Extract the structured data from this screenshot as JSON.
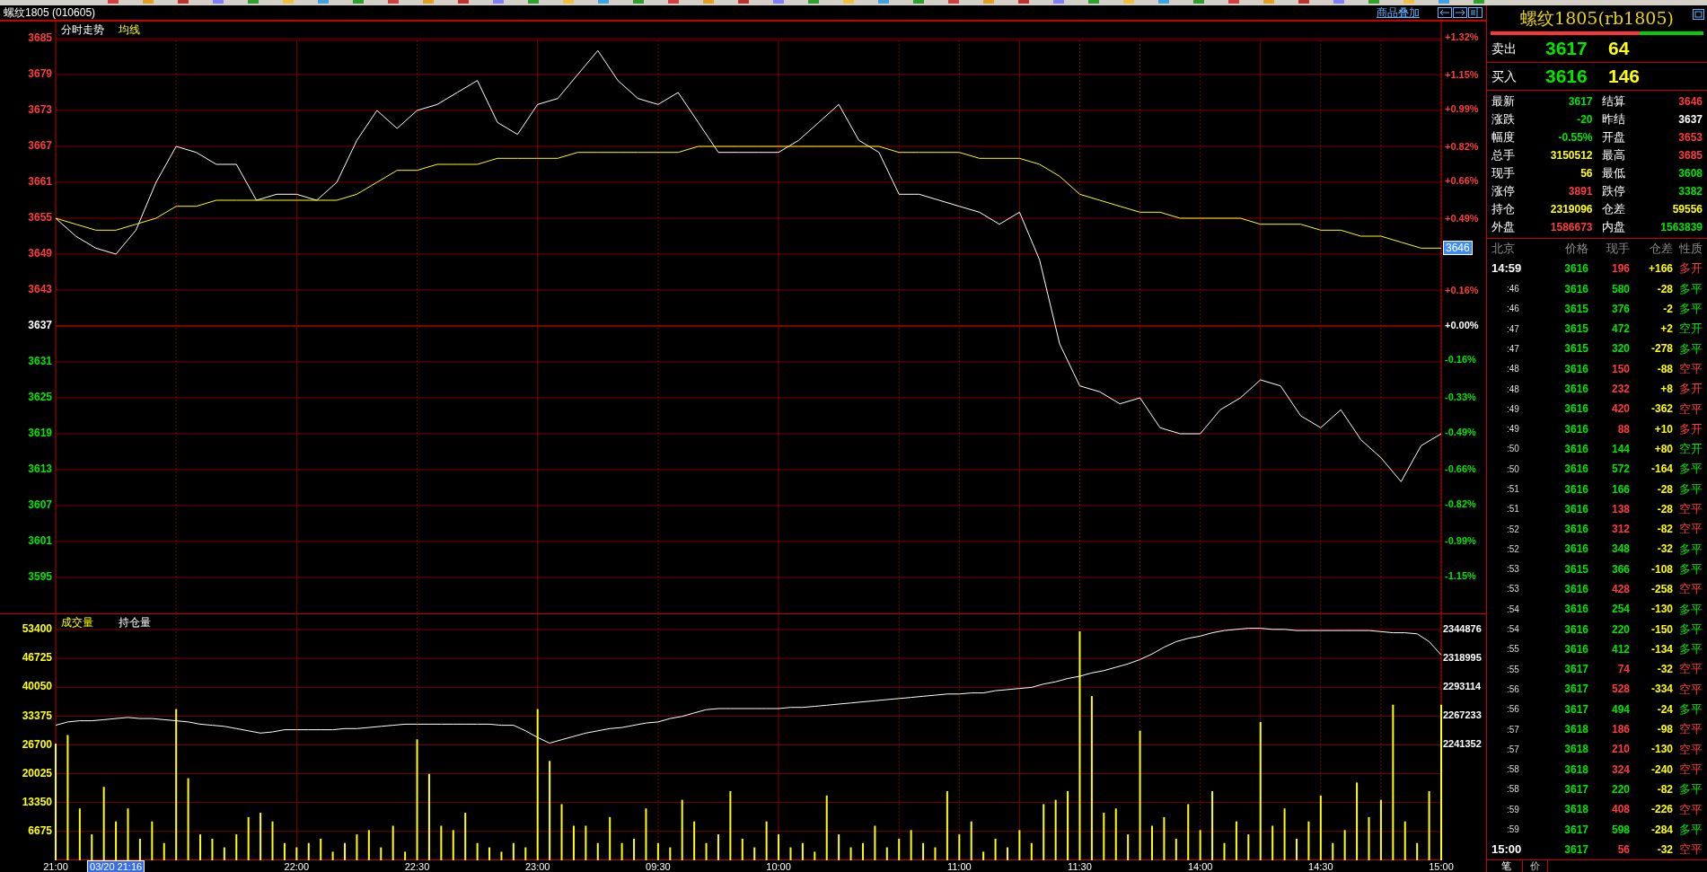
{
  "title_bar": {
    "title": "螺纹1805 (010605)",
    "link": "商品叠加"
  },
  "price_chart": {
    "price_marker": "3646",
    "chart_data": {
      "type": "line",
      "grid": true,
      "categories": [
        null,
        null,
        null,
        null,
        null,
        null,
        null,
        null,
        null,
        null,
        null,
        null,
        null,
        null,
        null,
        null,
        null,
        null,
        null,
        null,
        null,
        null,
        null,
        null,
        null,
        null,
        null,
        null,
        null,
        null,
        null,
        null,
        null,
        null,
        null,
        null,
        null,
        null,
        null,
        null,
        null,
        null,
        null,
        null,
        null,
        null,
        null,
        null,
        null,
        null,
        null,
        null,
        null,
        null,
        null,
        null,
        null,
        null,
        null,
        null,
        null,
        null,
        null,
        null,
        null,
        null,
        null,
        null,
        null,
        null
      ],
      "ylim": [
        3589,
        3688
      ],
      "y2lim": [
        -1.32,
        1.4
      ],
      "ref_lines": [
        {
          "axis": "y",
          "value": 3637
        }
      ],
      "yticks": [
        3685,
        3679,
        3673,
        3667,
        3661,
        3655,
        3649,
        3643,
        3637,
        3631,
        3625,
        3619,
        3613,
        3607,
        3601,
        3595
      ],
      "y2ticks": [
        {
          "value": 1.32,
          "label": "+1.32%"
        },
        {
          "value": 1.15,
          "label": "+1.15%"
        },
        {
          "value": 0.99,
          "label": "+0.99%"
        },
        {
          "value": 0.82,
          "label": "+0.82%"
        },
        {
          "value": 0.66,
          "label": "+0.66%"
        },
        {
          "value": 0.49,
          "label": "+0.49%"
        },
        {
          "value": 0.16,
          "label": "+0.16%"
        },
        {
          "value": 0,
          "label": "+0.00%"
        },
        {
          "value": -0.16,
          "label": "-0.16%"
        },
        {
          "value": -0.33,
          "label": "-0.33%"
        },
        {
          "value": -0.49,
          "label": "-0.49%"
        },
        {
          "value": -0.66,
          "label": "-0.66%"
        },
        {
          "value": -0.82,
          "label": "-0.82%"
        },
        {
          "value": -0.99,
          "label": "-0.99%"
        },
        {
          "value": -1.15,
          "label": "-1.15%"
        }
      ],
      "series": [
        {
          "name": "分时走势",
          "color": "#ffffff",
          "values": [
            3655,
            3652,
            3650,
            3649,
            3653,
            3661,
            3667,
            3666,
            3664,
            3664,
            3658,
            3659,
            3659,
            3658,
            3661,
            3668,
            3673,
            3670,
            3673,
            3674,
            3676,
            3678,
            3671,
            3669,
            3674,
            3675,
            3679,
            3683,
            3678,
            3675,
            3674,
            3676,
            3671,
            3666,
            3666,
            3666,
            3666,
            3668,
            3671,
            3674,
            3668,
            3666,
            3659,
            3659,
            3658,
            3657,
            3656,
            3654,
            3656,
            3648,
            3634,
            3627,
            3626,
            3624,
            3625,
            3620,
            3619,
            3619,
            3623,
            3625,
            3628,
            3627,
            3622,
            3620,
            3623,
            3618,
            3615,
            3611,
            3617,
            3619
          ]
        },
        {
          "name": "均线",
          "color": "#ffff00",
          "values": [
            3655,
            3654,
            3653,
            3653,
            3654,
            3655,
            3657,
            3657,
            3658,
            3658,
            3658,
            3658,
            3658,
            3658,
            3658,
            3659,
            3661,
            3663,
            3663,
            3664,
            3664,
            3664,
            3665,
            3665,
            3665,
            3665,
            3666,
            3666,
            3666,
            3666,
            3666,
            3666,
            3667,
            3667,
            3667,
            3667,
            3667,
            3667,
            3667,
            3667,
            3667,
            3667,
            3666,
            3666,
            3666,
            3666,
            3665,
            3665,
            3665,
            3664,
            3662,
            3659,
            3658,
            3657,
            3656,
            3656,
            3655,
            3655,
            3655,
            3655,
            3654,
            3654,
            3654,
            3653,
            3653,
            3652,
            3652,
            3651,
            3650,
            3650
          ]
        }
      ]
    }
  },
  "volume_chart": {
    "cursor_label": "03/20 21:16",
    "chart_data": {
      "type": "bar",
      "grid": true,
      "ylim": [
        0,
        57140
      ],
      "y2lim": [
        2137828,
        2359377
      ],
      "categories": [
        "21:00",
        null,
        null,
        null,
        null,
        null,
        null,
        null,
        null,
        null,
        null,
        null,
        null,
        null,
        null,
        null,
        null,
        null,
        null,
        null,
        "22:00",
        null,
        null,
        null,
        null,
        null,
        null,
        null,
        null,
        null,
        "22:30",
        null,
        null,
        null,
        null,
        null,
        null,
        null,
        null,
        null,
        "23:00",
        null,
        null,
        null,
        null,
        null,
        null,
        null,
        null,
        null,
        "09:30",
        null,
        null,
        null,
        null,
        null,
        null,
        null,
        null,
        null,
        "10:00",
        null,
        null,
        null,
        null,
        null,
        null,
        null,
        null,
        null,
        null,
        null,
        null,
        null,
        null,
        "11:00",
        null,
        null,
        null,
        null,
        null,
        null,
        null,
        null,
        null,
        "11:30",
        null,
        null,
        null,
        null,
        null,
        null,
        null,
        null,
        null,
        "14:00",
        null,
        null,
        null,
        null,
        null,
        null,
        null,
        null,
        null,
        "14:30",
        null,
        null,
        null,
        null,
        null,
        null,
        null,
        null,
        null,
        "15:00"
      ],
      "yticks": [
        53400,
        46725,
        40050,
        33375,
        26700,
        20025,
        13350,
        6675
      ],
      "y2ticks": [
        2344876,
        2318995,
        2293114,
        2267233,
        2241352
      ],
      "series": [
        {
          "name": "成交量",
          "color": "#ffff00",
          "values": [
            27000,
            29000,
            12000,
            6000,
            17000,
            9000,
            12000,
            5000,
            9000,
            4000,
            35000,
            19000,
            6000,
            5000,
            3000,
            6000,
            10000,
            11000,
            9000,
            4000,
            3000,
            4000,
            5000,
            2000,
            4000,
            6000,
            7000,
            3000,
            8000,
            2000,
            28000,
            20000,
            8000,
            7000,
            11000,
            4000,
            3000,
            2000,
            4000,
            3000,
            35000,
            23000,
            13000,
            8000,
            8000,
            4000,
            10000,
            4000,
            5000,
            12000,
            4000,
            3000,
            14000,
            9000,
            4000,
            6000,
            16000,
            5000,
            3000,
            9000,
            6000,
            3000,
            4000,
            2000,
            15000,
            6000,
            3000,
            4000,
            8000,
            3000,
            5000,
            7000,
            4000,
            3000,
            16000,
            6000,
            9000,
            2000,
            5000,
            3000,
            7000,
            4000,
            13000,
            14000,
            16000,
            53000,
            38000,
            11000,
            12000,
            6000,
            30000,
            8000,
            10000,
            5000,
            13000,
            7000,
            16000,
            4000,
            9000,
            6000,
            32000,
            8000,
            12000,
            5000,
            9000,
            15000,
            4000,
            7000,
            18000,
            10000,
            14000,
            36000,
            9000,
            4000,
            16000,
            36000
          ]
        },
        {
          "name": "持仓量",
          "color": "#ffffff",
          "type": "line",
          "axis": "y2",
          "values": [
            2259000,
            2262000,
            2263000,
            2263000,
            2264000,
            2265000,
            2266000,
            2265000,
            2265000,
            2264000,
            2263000,
            2262000,
            2260000,
            2259000,
            2258000,
            2256000,
            2254000,
            2252000,
            2253000,
            2255000,
            2255000,
            2255000,
            2255000,
            2255000,
            2256000,
            2256000,
            2257000,
            2258000,
            2259000,
            2260000,
            2260000,
            2260000,
            2260000,
            2260000,
            2260000,
            2260000,
            2260000,
            2259000,
            2259000,
            2254000,
            2248000,
            2243000,
            2246000,
            2249000,
            2252000,
            2254000,
            2256000,
            2257000,
            2259000,
            2261000,
            2262000,
            2265000,
            2267000,
            2270000,
            2273000,
            2274000,
            2274000,
            2274000,
            2274000,
            2274000,
            2274000,
            2275000,
            2275000,
            2276000,
            2277000,
            2278000,
            2279000,
            2280000,
            2281000,
            2282000,
            2283000,
            2284000,
            2285000,
            2286000,
            2287000,
            2287000,
            2288000,
            2288000,
            2290000,
            2291000,
            2292000,
            2293000,
            2296000,
            2298000,
            2301000,
            2303000,
            2306000,
            2308000,
            2311000,
            2314000,
            2318000,
            2323000,
            2329000,
            2334000,
            2337000,
            2339000,
            2342000,
            2344000,
            2345000,
            2346000,
            2346000,
            2345000,
            2345000,
            2344000,
            2344000,
            2344000,
            2344000,
            2344000,
            2344000,
            2344000,
            2343000,
            2342000,
            2342000,
            2341000,
            2334000,
            2322000
          ]
        }
      ]
    }
  },
  "quote": {
    "title": "螺纹1805(rb1805)",
    "balance": {
      "level": 0.7
    },
    "book": [
      {
        "label": "卖出",
        "price": "3617",
        "volume": "64"
      },
      {
        "label": "买入",
        "price": "3616",
        "volume": "146"
      }
    ],
    "stats": [
      {
        "label": "最新",
        "value": "3617",
        "color": "#00e600"
      },
      {
        "label": "结算",
        "value": "3646",
        "color": "#ff3c3c"
      },
      {
        "label": "涨跌",
        "value": "-20",
        "color": "#00e600"
      },
      {
        "label": "昨结",
        "value": "3637",
        "color": "#ffffff"
      },
      {
        "label": "幅度",
        "value": "-0.55%",
        "color": "#00e600"
      },
      {
        "label": "开盘",
        "value": "3653",
        "color": "#ff3c3c"
      },
      {
        "label": "总手",
        "value": "3150512",
        "color": "#ffff00"
      },
      {
        "label": "最高",
        "value": "3685",
        "color": "#ff3c3c"
      },
      {
        "label": "现手",
        "value": "56",
        "color": "#ffff00"
      },
      {
        "label": "最低",
        "value": "3608",
        "color": "#00e600"
      },
      {
        "label": "涨停",
        "value": "3891",
        "color": "#ff3c3c"
      },
      {
        "label": "跌停",
        "value": "3382",
        "color": "#00e600"
      },
      {
        "label": "持仓",
        "value": "2319096",
        "color": "#ffff00"
      },
      {
        "label": "仓差",
        "value": "59556",
        "color": "#ffff00"
      },
      {
        "label": "外盘",
        "value": "1586673",
        "color": "#ff3c3c"
      },
      {
        "label": "内盘",
        "value": "1563839",
        "color": "#00e600"
      }
    ],
    "ticks": {
      "columns": [
        "北京",
        "价格",
        "现手",
        "仓差",
        "性质"
      ],
      "rows": [
        {
          "kind": "hour",
          "time": "14:59",
          "price": "3616",
          "volume": "196",
          "change": "+166",
          "nature": "多开",
          "color": "#ff3c3c"
        },
        {
          "kind": "minute",
          "time": ":46",
          "price": "3616",
          "volume": "580",
          "change": "-28",
          "nature": "多平",
          "color": "#00e600"
        },
        {
          "kind": "minute",
          "time": ":46",
          "price": "3615",
          "volume": "376",
          "change": "-2",
          "nature": "多平",
          "color": "#00e600"
        },
        {
          "kind": "minute",
          "time": ":47",
          "price": "3615",
          "volume": "472",
          "change": "+2",
          "nature": "空开",
          "color": "#00e600"
        },
        {
          "kind": "minute",
          "time": ":47",
          "price": "3615",
          "volume": "320",
          "change": "-278",
          "nature": "多平",
          "color": "#00e600"
        },
        {
          "kind": "minute",
          "time": ":48",
          "price": "3616",
          "volume": "150",
          "change": "-88",
          "nature": "空平",
          "color": "#ff3c3c"
        },
        {
          "kind": "minute",
          "time": ":48",
          "price": "3616",
          "volume": "232",
          "change": "+8",
          "nature": "多开",
          "color": "#ff3c3c"
        },
        {
          "kind": "minute",
          "time": ":49",
          "price": "3616",
          "volume": "420",
          "change": "-362",
          "nature": "空平",
          "color": "#ff3c3c"
        },
        {
          "kind": "minute",
          "time": ":49",
          "price": "3616",
          "volume": "88",
          "change": "+10",
          "nature": "多开",
          "color": "#ff3c3c"
        },
        {
          "kind": "minute",
          "time": ":50",
          "price": "3616",
          "volume": "144",
          "change": "+80",
          "nature": "空开",
          "color": "#00e600"
        },
        {
          "kind": "minute",
          "time": ":50",
          "price": "3616",
          "volume": "572",
          "change": "-164",
          "nature": "多平",
          "color": "#00e600"
        },
        {
          "kind": "minute",
          "time": ":51",
          "price": "3616",
          "volume": "166",
          "change": "-28",
          "nature": "多平",
          "color": "#00e600"
        },
        {
          "kind": "minute",
          "time": ":51",
          "price": "3616",
          "volume": "138",
          "change": "-28",
          "nature": "空平",
          "color": "#ff3c3c"
        },
        {
          "kind": "minute",
          "time": ":52",
          "price": "3616",
          "volume": "312",
          "change": "-82",
          "nature": "空平",
          "color": "#ff3c3c"
        },
        {
          "kind": "minute",
          "time": ":52",
          "price": "3616",
          "volume": "348",
          "change": "-32",
          "nature": "多平",
          "color": "#00e600"
        },
        {
          "kind": "minute",
          "time": ":53",
          "price": "3615",
          "volume": "366",
          "change": "-108",
          "nature": "多平",
          "color": "#00e600"
        },
        {
          "kind": "minute",
          "time": ":53",
          "price": "3616",
          "volume": "428",
          "change": "-258",
          "nature": "空平",
          "color": "#ff3c3c"
        },
        {
          "kind": "minute",
          "time": ":54",
          "price": "3616",
          "volume": "254",
          "change": "-130",
          "nature": "多平",
          "color": "#00e600"
        },
        {
          "kind": "minute",
          "time": ":54",
          "price": "3616",
          "volume": "220",
          "change": "-150",
          "nature": "多平",
          "color": "#00e600"
        },
        {
          "kind": "minute",
          "time": ":55",
          "price": "3616",
          "volume": "412",
          "change": "-134",
          "nature": "多平",
          "color": "#00e600"
        },
        {
          "kind": "minute",
          "time": ":55",
          "price": "3617",
          "volume": "74",
          "change": "-32",
          "nature": "空平",
          "color": "#ff3c3c"
        },
        {
          "kind": "minute",
          "time": ":56",
          "price": "3617",
          "volume": "528",
          "change": "-334",
          "nature": "空平",
          "color": "#ff3c3c"
        },
        {
          "kind": "minute",
          "time": ":56",
          "price": "3617",
          "volume": "494",
          "change": "-24",
          "nature": "多平",
          "color": "#00e600"
        },
        {
          "kind": "minute",
          "time": ":57",
          "price": "3618",
          "volume": "186",
          "change": "-98",
          "nature": "空平",
          "color": "#ff3c3c"
        },
        {
          "kind": "minute",
          "time": ":57",
          "price": "3618",
          "volume": "210",
          "change": "-130",
          "nature": "空平",
          "color": "#ff3c3c"
        },
        {
          "kind": "minute",
          "time": ":58",
          "price": "3618",
          "volume": "324",
          "change": "-240",
          "nature": "空平",
          "color": "#ff3c3c"
        },
        {
          "kind": "minute",
          "time": ":58",
          "price": "3617",
          "volume": "220",
          "change": "-82",
          "nature": "多平",
          "color": "#00e600"
        },
        {
          "kind": "minute",
          "time": ":59",
          "price": "3618",
          "volume": "408",
          "change": "-226",
          "nature": "空平",
          "color": "#ff3c3c"
        },
        {
          "kind": "minute",
          "time": ":59",
          "price": "3617",
          "volume": "598",
          "change": "-284",
          "nature": "多平",
          "color": "#00e600"
        },
        {
          "kind": "hour",
          "time": "15:00",
          "price": "3617",
          "volume": "56",
          "change": "-32",
          "nature": "空平",
          "color": "#ff3c3c"
        }
      ]
    },
    "tabs": [
      {
        "label": "笔",
        "selected": true
      },
      {
        "label": "价",
        "selected": false
      }
    ]
  }
}
